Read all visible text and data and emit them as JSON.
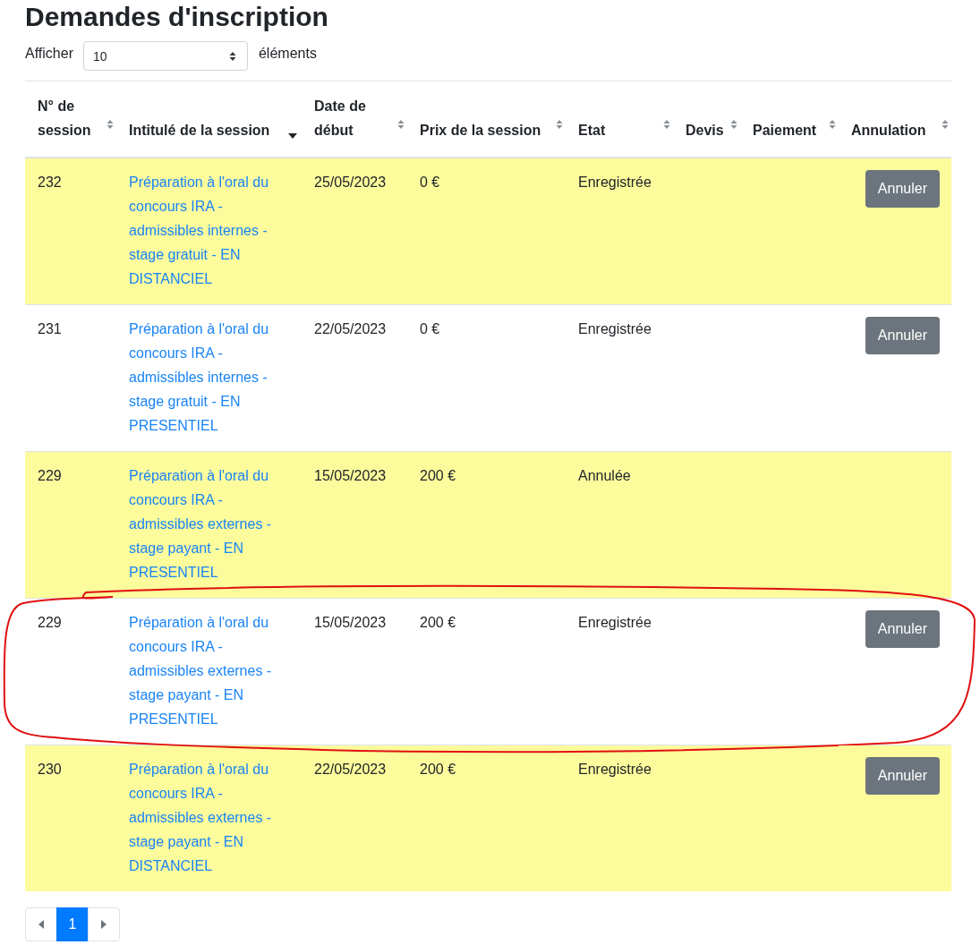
{
  "title": "Demandes d'inscription",
  "length_control": {
    "prefix": "Afficher",
    "value": "10",
    "suffix": "éléments"
  },
  "table": {
    "columns": [
      {
        "label": "N° de session",
        "sorted": false
      },
      {
        "label": "Intitulé de la session",
        "sorted": true
      },
      {
        "label": "Date de début",
        "sorted": false
      },
      {
        "label": "Prix de la session",
        "sorted": false
      },
      {
        "label": "Etat",
        "sorted": false
      },
      {
        "label": "Devis",
        "sorted": false
      },
      {
        "label": "Paiement",
        "sorted": false
      },
      {
        "label": "Annulation",
        "sorted": false
      }
    ],
    "rows": [
      {
        "number": "232",
        "title": "Préparation à l'oral du concours IRA - admissibles internes - stage gratuit - EN DISTANCIEL",
        "date": "25/05/2023",
        "price": "0 €",
        "status": "Enregistrée",
        "highlighted": true,
        "circled": false,
        "cancel_button": "Annuler"
      },
      {
        "number": "231",
        "title": "Préparation à l'oral du concours IRA - admissibles internes - stage gratuit - EN PRESENTIEL",
        "date": "22/05/2023",
        "price": "0 €",
        "status": "Enregistrée",
        "highlighted": false,
        "circled": false,
        "cancel_button": "Annuler"
      },
      {
        "number": "229",
        "title": "Préparation à l'oral du concours IRA - admissibles externes - stage payant - EN PRESENTIEL",
        "date": "15/05/2023",
        "price": "200 €",
        "status": "Annulée",
        "highlighted": true,
        "circled": false
      },
      {
        "number": "229",
        "title": "Préparation à l'oral du concours IRA - admissibles externes - stage payant - EN PRESENTIEL",
        "date": "15/05/2023",
        "price": "200 €",
        "status": "Enregistrée",
        "highlighted": false,
        "circled": true,
        "cancel_button": "Annuler"
      },
      {
        "number": "230",
        "title": "Préparation à l'oral du concours IRA - admissibles externes - stage payant - EN DISTANCIEL",
        "date": "22/05/2023",
        "price": "200 €",
        "status": "Enregistrée",
        "highlighted": true,
        "circled": false,
        "cancel_button": "Annuler"
      }
    ]
  },
  "pagination": {
    "pages": [
      {
        "label": "1",
        "selected": true
      }
    ]
  }
}
